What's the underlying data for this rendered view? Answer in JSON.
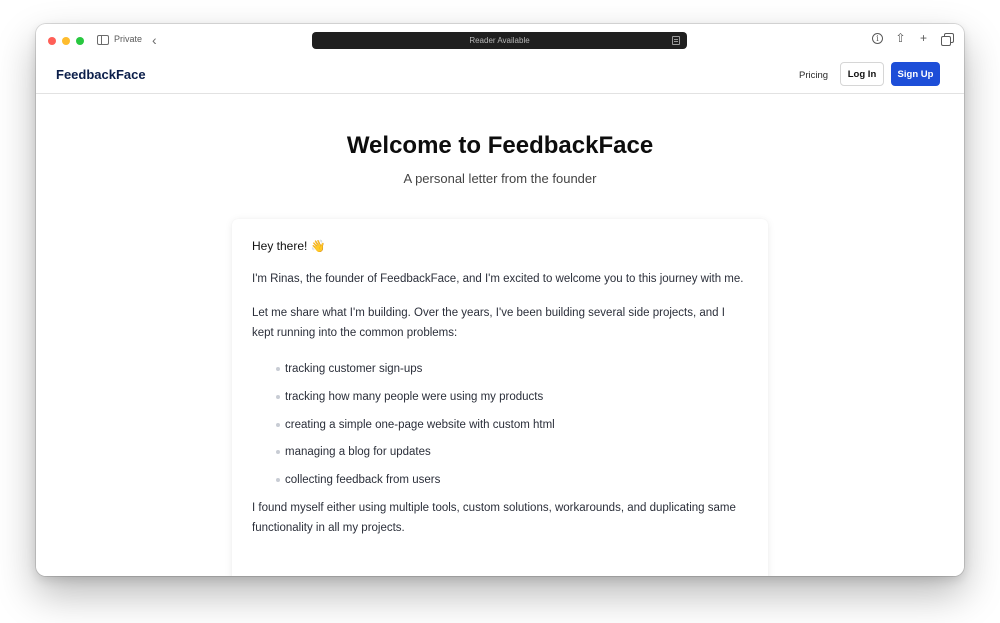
{
  "browser": {
    "private_label": "Private",
    "address_text": "Reader Available",
    "colors": {
      "red": "#ff5f57",
      "yellow": "#febc2e",
      "green": "#28c840"
    }
  },
  "nav": {
    "logo": "FeedbackFace",
    "pricing": "Pricing",
    "login": "Log In",
    "signup": "Sign Up",
    "accent_color": "#1d4ed8"
  },
  "hero": {
    "title": "Welcome to FeedbackFace",
    "subtitle": "A personal letter from the founder"
  },
  "letter": {
    "greeting": "Hey there! 👋",
    "paragraph1": "I'm Rinas, the founder of FeedbackFace, and I'm excited to welcome you to this journey with me.",
    "paragraph2": "Let me share what I'm building. Over the years, I've been building several side projects, and I kept running into the common problems:",
    "problems": [
      "tracking customer sign-ups",
      "tracking how many people were using my products",
      "creating a simple one-page website with custom html",
      "managing a blog for updates",
      "collecting feedback from users"
    ],
    "paragraph3": "I found myself either using multiple tools, custom solutions, workarounds, and duplicating same functionality in all my projects."
  }
}
